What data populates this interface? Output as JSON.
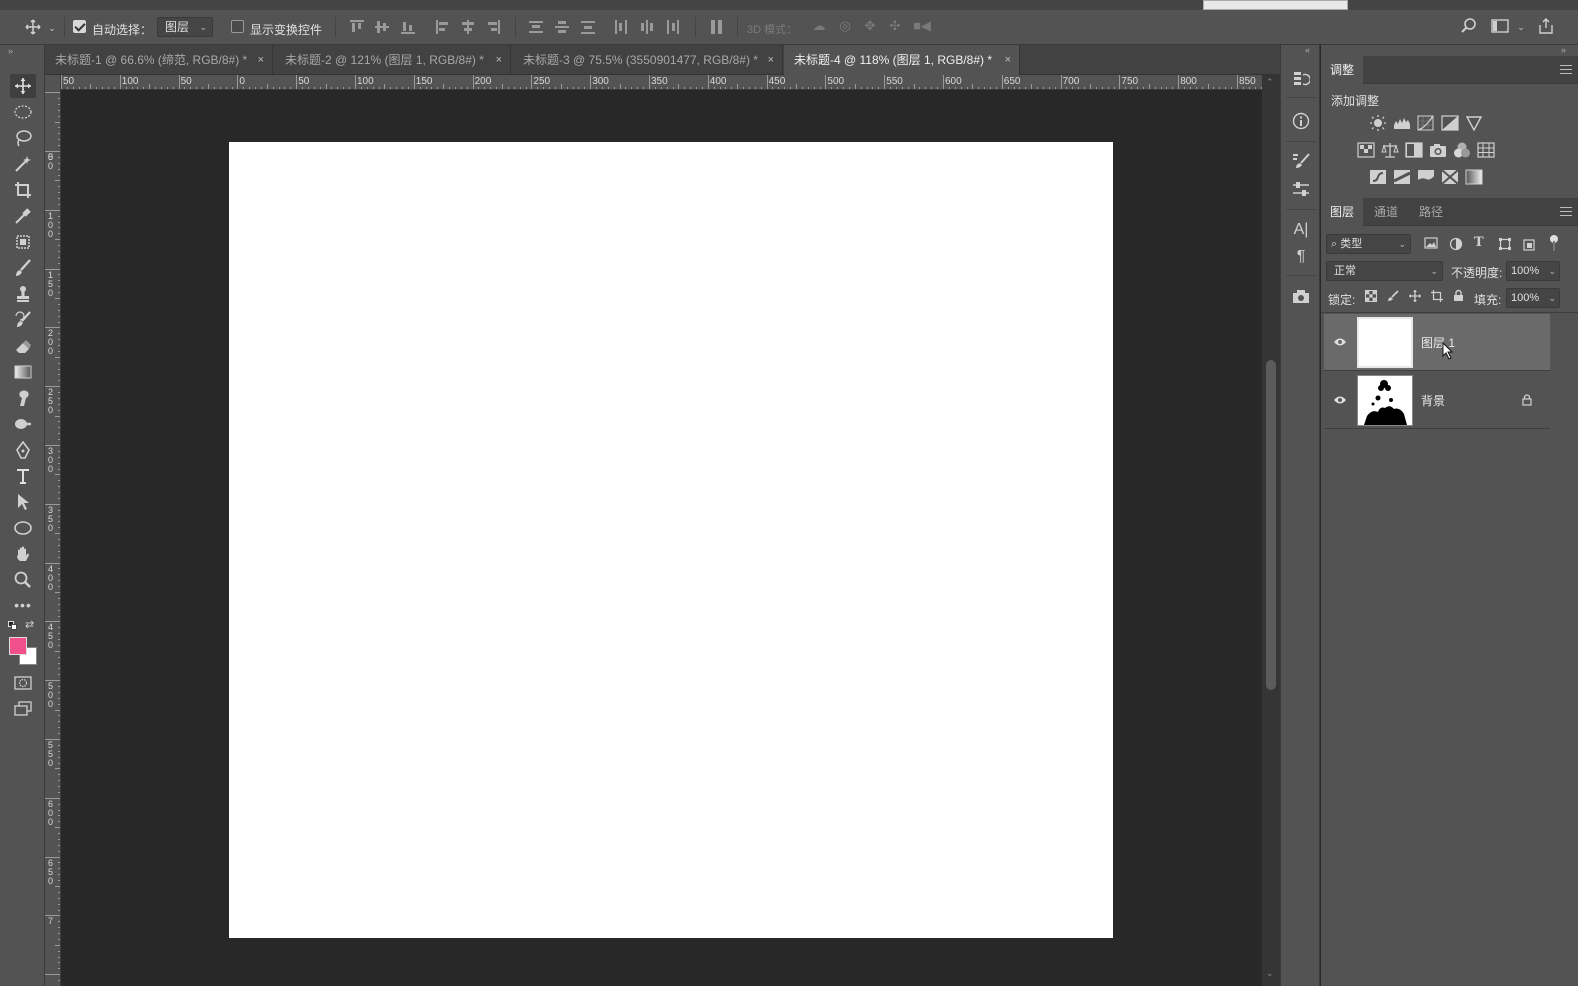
{
  "optionsBar": {
    "auto_select_label": "自动选择：",
    "auto_select_target": "图层",
    "show_transform_label": "显示变换控件",
    "mode_3d_label": "3D 模式："
  },
  "tabs": [
    {
      "label": "未标题-1 @ 66.6% (缔范, RGB/8#) *",
      "close": "×"
    },
    {
      "label": "未标题-2 @ 121% (图层 1, RGB/8#) *",
      "close": "×"
    },
    {
      "label": "未标题-3 @ 75.5% (3550901477, RGB/8#) *",
      "close": "×"
    },
    {
      "label": "未标题-4 @ 118% (图层 1, RGB/8#) *",
      "close": "×"
    }
  ],
  "hruler": [
    "50",
    "100",
    "50",
    "0",
    "50",
    "100",
    "150",
    "200",
    "250",
    "300",
    "350",
    "400",
    "450",
    "500",
    "550",
    "600",
    "650",
    "700",
    "750",
    "800",
    "850"
  ],
  "vruler": [
    "0",
    "5\n0",
    "1\n0\n0",
    "1\n5\n0",
    "2\n0\n0",
    "2\n5\n0",
    "3\n0\n0",
    "3\n5\n0",
    "4\n0\n0",
    "4\n5\n0",
    "5\n0\n0",
    "5\n5\n0",
    "6\n0\n0",
    "6\n5\n0",
    "7"
  ],
  "adjustments": {
    "tab": "调整",
    "add_label": "添加调整"
  },
  "layersPanel": {
    "tabs": [
      "图层",
      "通道",
      "路径"
    ],
    "filter_label": "类型",
    "blend_mode": "正常",
    "opacity_label": "不透明度:",
    "opacity_value": "100%",
    "lock_label": "锁定:",
    "fill_label": "填充:",
    "fill_value": "100%",
    "layers": [
      {
        "name": "图层 1",
        "selected": true
      },
      {
        "name": "背景",
        "selected": false,
        "locked": true
      }
    ]
  },
  "colors": {
    "foreground": "#f0508c",
    "background": "#ffffff",
    "canvas": "#ffffff",
    "workspace": "#282828"
  },
  "icons": [
    "move-icon",
    "marquee-icon",
    "lasso-icon",
    "magic-wand-icon",
    "crop-icon",
    "eyedropper-icon",
    "frame-icon",
    "brush-icon",
    "stamp-icon",
    "history-brush-icon",
    "eraser-icon",
    "gradient-icon",
    "smudge-icon",
    "dodge-icon",
    "pen-icon",
    "type-icon",
    "path-select-icon",
    "ellipse-icon",
    "hand-icon",
    "zoom-icon",
    "more-icon",
    "quick-mask-icon",
    "screen-mode-icon",
    "search-icon",
    "workspace-icon",
    "share-icon"
  ]
}
